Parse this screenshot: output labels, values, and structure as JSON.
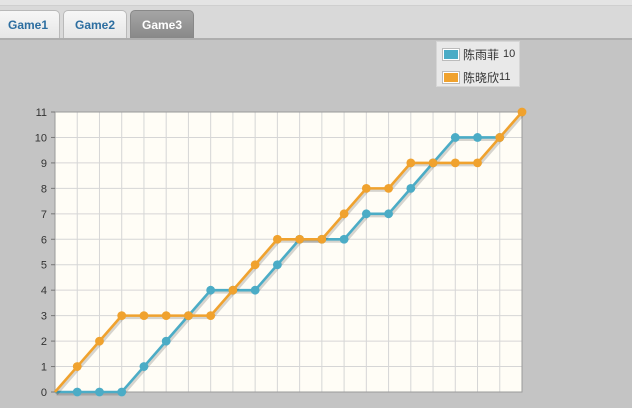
{
  "tabs": [
    {
      "label": "Game1",
      "active": false
    },
    {
      "label": "Game2",
      "active": false
    },
    {
      "label": "Game3",
      "active": true
    }
  ],
  "colors": {
    "series1": "#4bacc6",
    "series2": "#f0a22e"
  },
  "legend": [
    {
      "name": "陈雨菲",
      "value": "10"
    },
    {
      "name": "陈晓欣",
      "value": "11"
    }
  ],
  "chart_data": {
    "type": "line",
    "x": [
      0,
      1,
      2,
      3,
      4,
      5,
      6,
      7,
      8,
      9,
      10,
      11,
      12,
      13,
      14,
      15,
      16,
      17,
      18,
      19,
      20,
      21
    ],
    "series": [
      {
        "name": "陈雨菲",
        "values": [
          0,
          0,
          0,
          0,
          1,
          2,
          3,
          4,
          4,
          4,
          5,
          6,
          6,
          6,
          7,
          7,
          8,
          9,
          10,
          10,
          10
        ]
      },
      {
        "name": "陈晓欣",
        "values": [
          0,
          1,
          2,
          3,
          3,
          3,
          3,
          3,
          4,
          5,
          6,
          6,
          6,
          7,
          8,
          8,
          9,
          9,
          9,
          9,
          10,
          11
        ]
      }
    ],
    "yticks": [
      0,
      1,
      2,
      3,
      4,
      5,
      6,
      7,
      8,
      9,
      10,
      11
    ],
    "ylim": [
      0,
      11
    ],
    "xlim": [
      0,
      21
    ],
    "grid": true,
    "legend_position": "top-right"
  }
}
